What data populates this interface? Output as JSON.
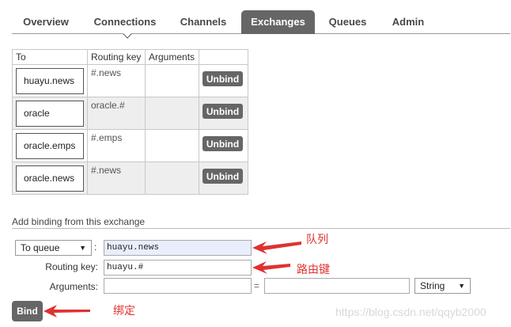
{
  "nav": {
    "tabs": [
      {
        "label": "Overview",
        "active": false
      },
      {
        "label": "Connections",
        "active": false
      },
      {
        "label": "Channels",
        "active": false
      },
      {
        "label": "Exchanges",
        "active": true
      },
      {
        "label": "Queues",
        "active": false
      },
      {
        "label": "Admin",
        "active": false
      }
    ]
  },
  "bindings": {
    "headers": [
      "To",
      "Routing key",
      "Arguments"
    ],
    "rows": [
      {
        "to": "huayu.news",
        "routing_key": "#.news",
        "arguments": "",
        "action": "Unbind"
      },
      {
        "to": "oracle",
        "routing_key": "oracle.#",
        "arguments": "",
        "action": "Unbind"
      },
      {
        "to": "oracle.emps",
        "routing_key": "#.emps",
        "arguments": "",
        "action": "Unbind"
      },
      {
        "to": "oracle.news",
        "routing_key": "#.news",
        "arguments": "",
        "action": "Unbind"
      }
    ]
  },
  "add_binding": {
    "section_title": "Add binding from this exchange",
    "destination_type": "To queue",
    "destination_value": "huayu.news",
    "routing_key_label": "Routing key:",
    "routing_key_value": "huayu.#",
    "arguments_label": "Arguments:",
    "argument_key": "",
    "argument_value": "",
    "argument_type": "String",
    "bind_label": "Bind"
  },
  "annotations": {
    "queue_note": "队列",
    "routing_key_note": "路由键",
    "bind_note": "绑定",
    "color": "#e03131"
  },
  "watermark": "https://blog.csdn.net/qqyb2000",
  "colors": {
    "active_tab": "#666666",
    "button": "#666666",
    "alt_row": "#eeeeee",
    "filled_input": "#e8eefc"
  }
}
